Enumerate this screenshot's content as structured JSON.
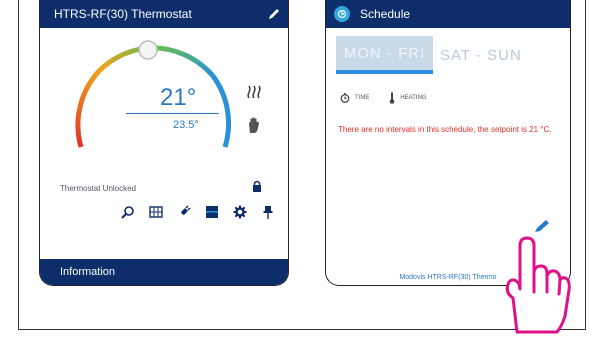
{
  "left_panel": {
    "title": "HTRS-RF(30) Thermostat",
    "setpoint": "21°",
    "actual": "23.5°",
    "lock_status": "Thermostat Unlocked",
    "info_label": "Information"
  },
  "right_panel": {
    "title": "Schedule",
    "tabs": [
      "MON - FRI",
      "SAT - SUN"
    ],
    "legend": {
      "time": "TIME",
      "heating": "HEATING"
    },
    "message": "There are no intervals in this schedule, the setpoint is 21 °C.",
    "footer": "Modovis HTRS-RF(30) Thermo"
  },
  "colors": {
    "header": "#0d2d6b",
    "accent": "#2a78c6",
    "warning": "#e0302a",
    "hand": "#e0108a"
  },
  "icons": [
    "edit-icon",
    "heat-waves-icon",
    "hand-icon",
    "lock-icon",
    "search-icon",
    "calendar-icon",
    "plug-icon",
    "display-icon",
    "gear-icon",
    "pin-icon",
    "schedule-icon",
    "clock-icon",
    "thermometer-icon",
    "pointer-hand-icon"
  ]
}
